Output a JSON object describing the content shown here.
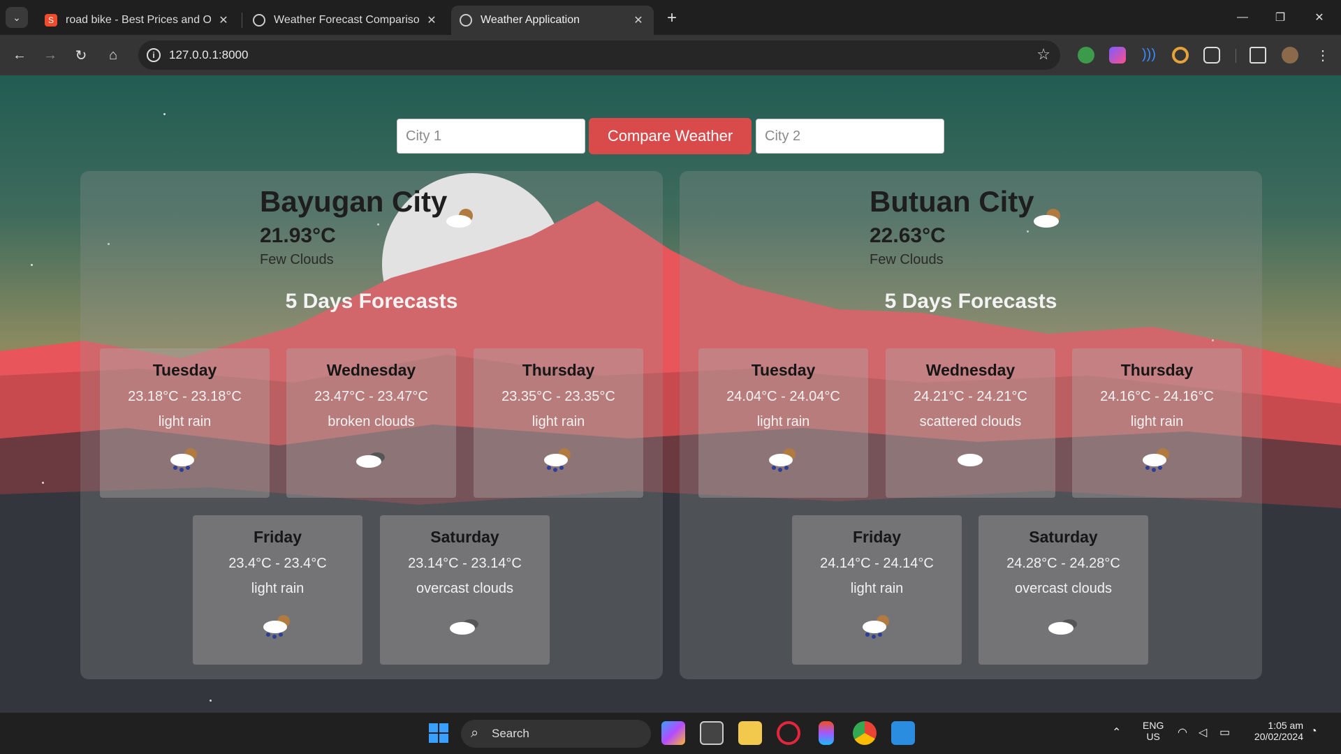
{
  "browser": {
    "tabs": [
      {
        "title": "road bike - Best Prices and Onli",
        "favicon": "shopee-icon",
        "active": false
      },
      {
        "title": "Weather Forecast Comparison",
        "favicon": "globe-icon",
        "active": false
      },
      {
        "title": "Weather Application",
        "favicon": "globe-icon",
        "active": true
      }
    ],
    "url": "127.0.0.1:8000"
  },
  "app": {
    "city1_placeholder": "City 1",
    "city2_placeholder": "City 2",
    "compare_label": "Compare Weather",
    "forecast_heading": "5 Days Forecasts",
    "cities": [
      {
        "name": "Bayugan City",
        "temp": "21.93°C",
        "desc": "Few Clouds",
        "forecast": [
          {
            "day": "Tuesday",
            "range": "23.18°C - 23.18°C",
            "desc": "light rain",
            "icon": "rain-cloud-icon"
          },
          {
            "day": "Wednesday",
            "range": "23.47°C - 23.47°C",
            "desc": "broken clouds",
            "icon": "cloud-icon"
          },
          {
            "day": "Thursday",
            "range": "23.35°C - 23.35°C",
            "desc": "light rain",
            "icon": "rain-cloud-icon"
          },
          {
            "day": "Friday",
            "range": "23.4°C - 23.4°C",
            "desc": "light rain",
            "icon": "rain-cloud-icon"
          },
          {
            "day": "Saturday",
            "range": "23.14°C - 23.14°C",
            "desc": "overcast clouds",
            "icon": "cloud-icon"
          }
        ]
      },
      {
        "name": "Butuan City",
        "temp": "22.63°C",
        "desc": "Few Clouds",
        "forecast": [
          {
            "day": "Tuesday",
            "range": "24.04°C - 24.04°C",
            "desc": "light rain",
            "icon": "rain-cloud-icon"
          },
          {
            "day": "Wednesday",
            "range": "24.21°C - 24.21°C",
            "desc": "scattered clouds",
            "icon": "cloud-icon"
          },
          {
            "day": "Thursday",
            "range": "24.16°C - 24.16°C",
            "desc": "light rain",
            "icon": "rain-cloud-icon"
          },
          {
            "day": "Friday",
            "range": "24.14°C - 24.14°C",
            "desc": "light rain",
            "icon": "rain-cloud-icon"
          },
          {
            "day": "Saturday",
            "range": "24.28°C - 24.28°C",
            "desc": "overcast clouds",
            "icon": "cloud-icon"
          }
        ]
      }
    ]
  },
  "taskbar": {
    "search_label": "Search",
    "lang_top": "ENG",
    "lang_bottom": "US",
    "time": "1:05 am",
    "date": "20/02/2024"
  },
  "colors": {
    "accent": "#d94b4b",
    "mountain": "#e8555a",
    "sky_top": "#215c52"
  }
}
